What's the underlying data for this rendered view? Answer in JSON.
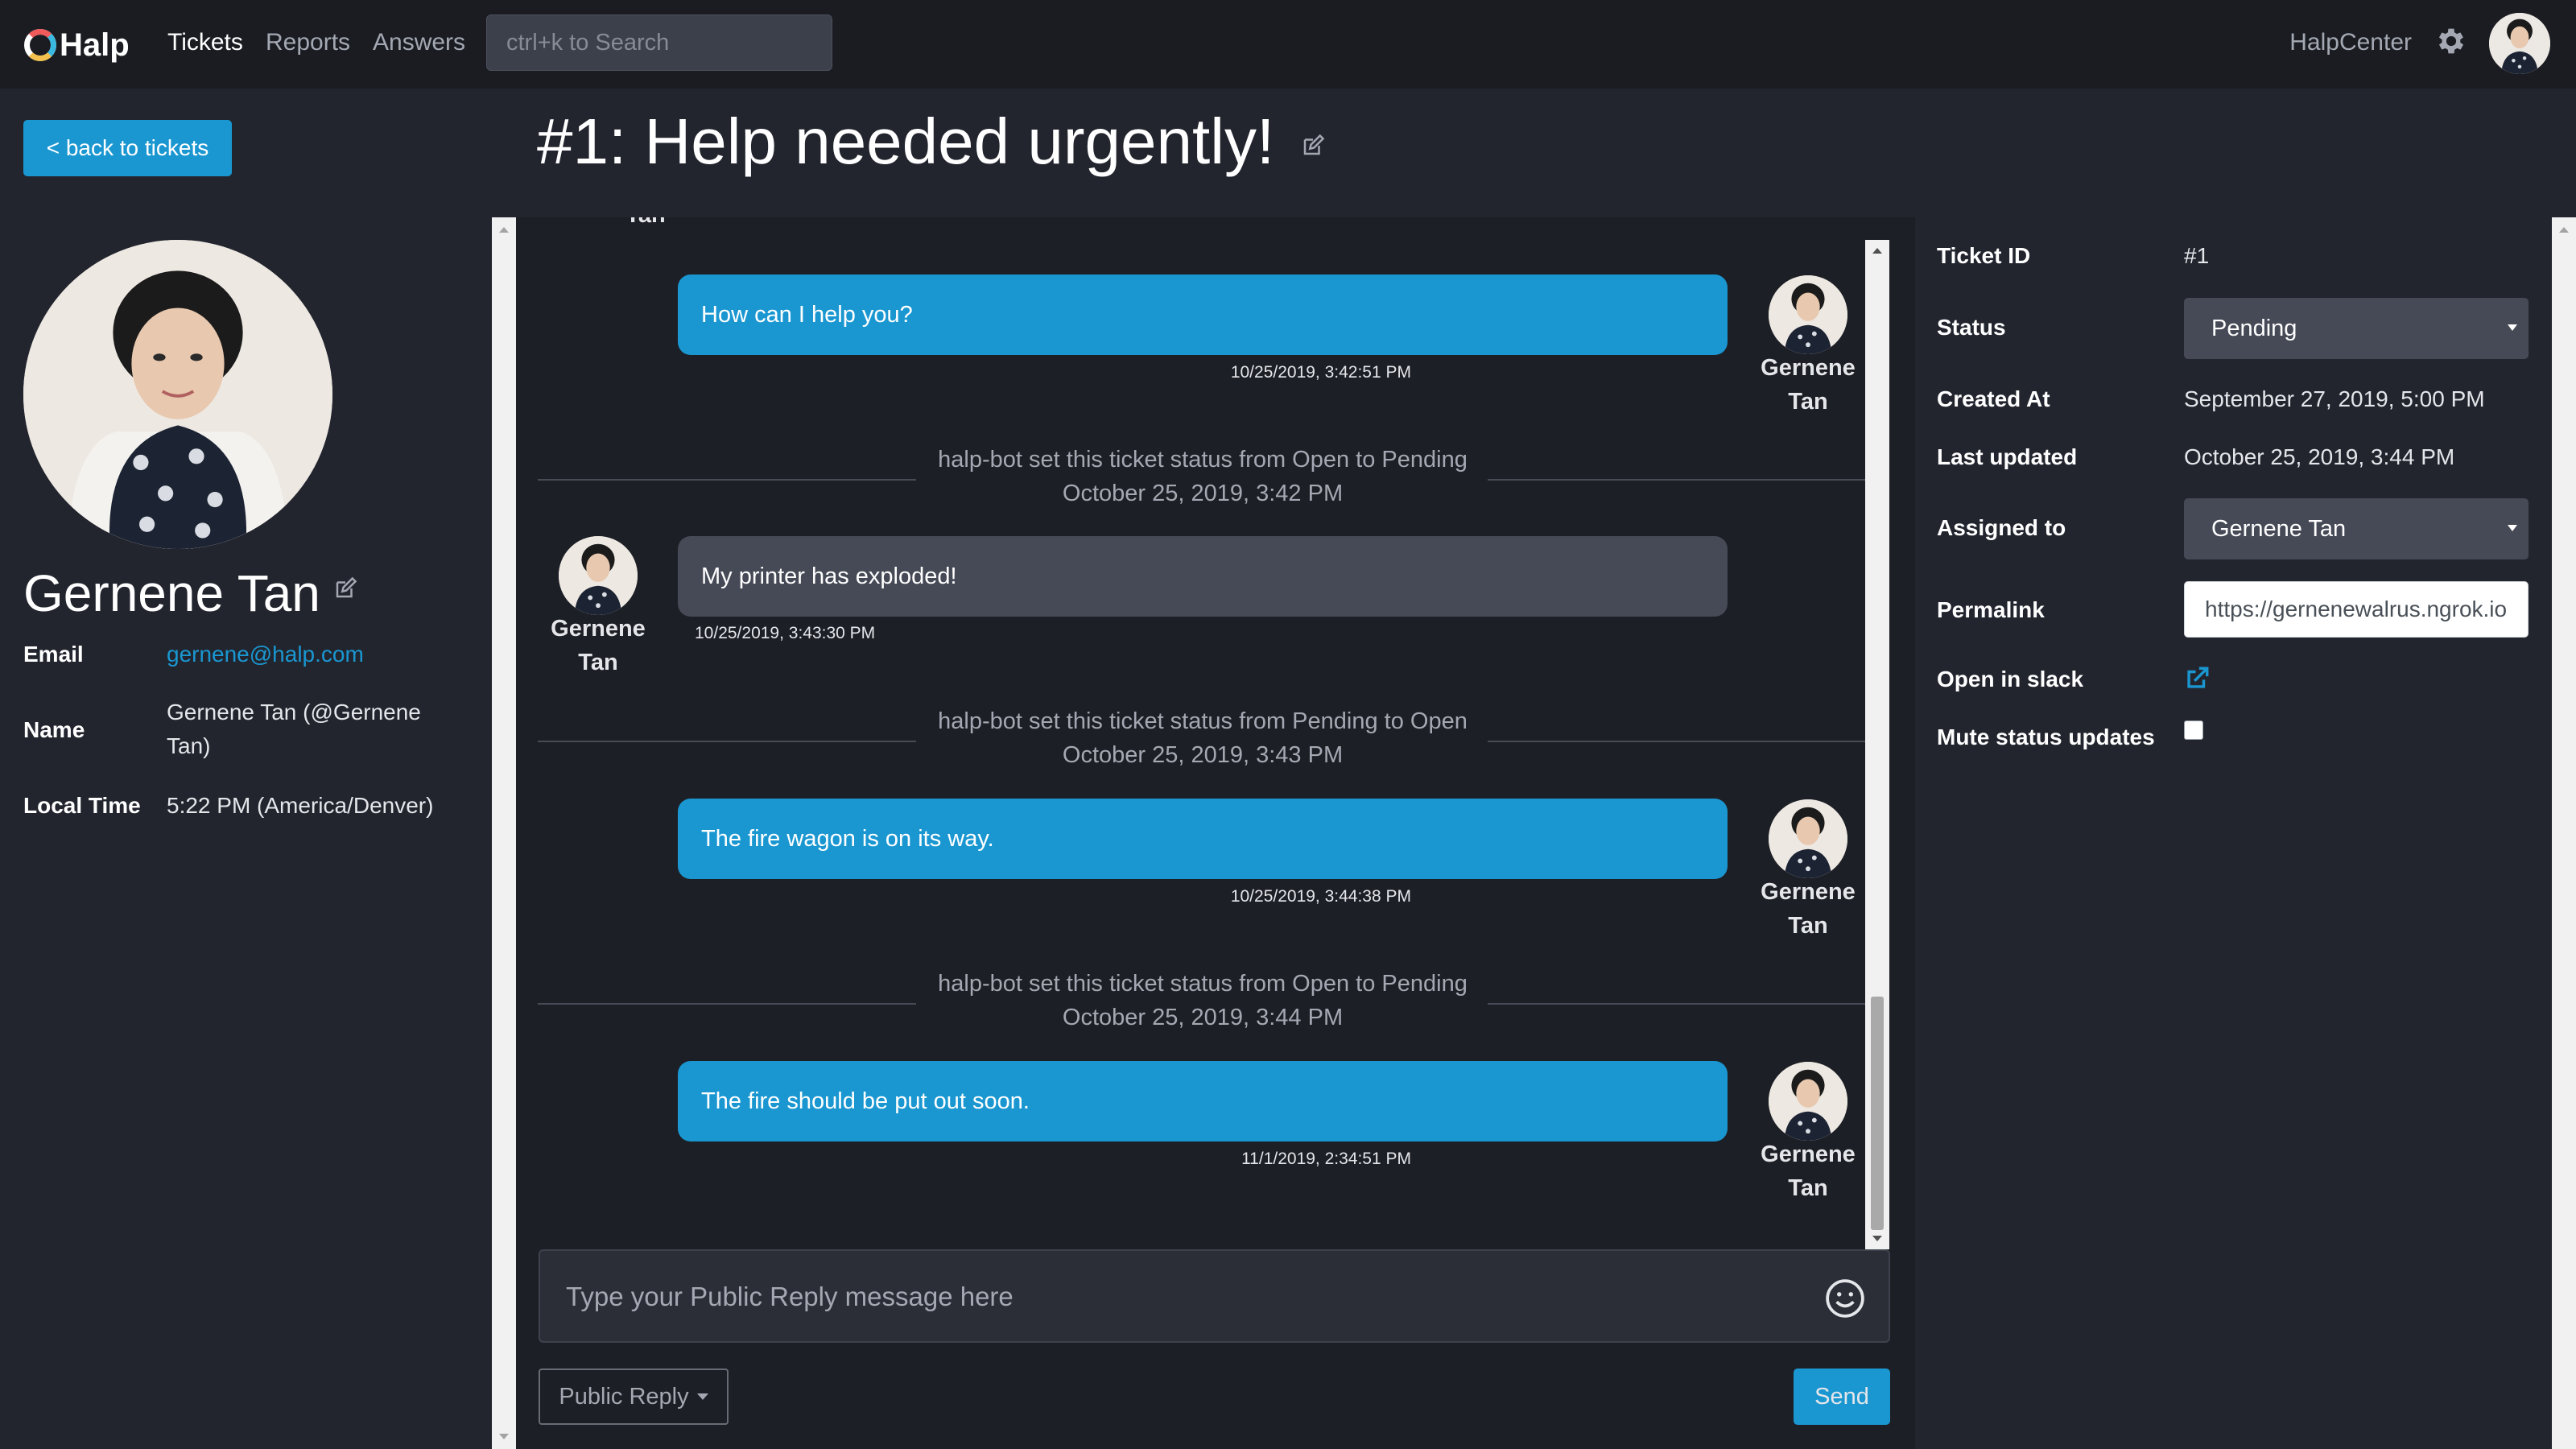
{
  "nav": {
    "logo_text": "Halp",
    "links": [
      "Tickets",
      "Reports",
      "Answers"
    ],
    "active": "Tickets",
    "search_placeholder": "ctrl+k to Search",
    "halpcenter": "HalpCenter",
    "icons": {
      "settings": "gear-icon",
      "avatar": "user-avatar"
    }
  },
  "back_button": "< back to tickets",
  "requester": {
    "name": "Gernene Tan",
    "email_label": "Email",
    "email": "gernene@halp.com",
    "name_label": "Name",
    "display_name_line1": "Gernene Tan (@Gernene",
    "display_name_line2": "Tan)",
    "local_time_label": "Local Time",
    "local_time": "5:22 PM (America/Denver)"
  },
  "ticket": {
    "title": "#1: Help needed urgently!"
  },
  "messages": [
    {
      "type": "agent",
      "text": "How can I help you?",
      "timestamp": "10/25/2019, 3:42:51 PM",
      "author_first": "Gernene",
      "author_last": "Tan"
    },
    {
      "type": "system",
      "text": "halp-bot set this ticket status from Open to Pending",
      "date": "October 25, 2019, 3:42 PM"
    },
    {
      "type": "user",
      "text": "My printer has exploded!",
      "timestamp": "10/25/2019, 3:43:30 PM",
      "author_first": "Gernene",
      "author_last": "Tan"
    },
    {
      "type": "system",
      "text": "halp-bot set this ticket status from Pending to Open",
      "date": "October 25, 2019, 3:43 PM"
    },
    {
      "type": "agent",
      "text": "The fire wagon is on its way.",
      "timestamp": "10/25/2019, 3:44:38 PM",
      "author_first": "Gernene",
      "author_last": "Tan"
    },
    {
      "type": "system",
      "text": "halp-bot set this ticket status from Open to Pending",
      "date": "October 25, 2019, 3:44 PM"
    },
    {
      "type": "agent",
      "text": "The fire should be put out soon.",
      "timestamp": "11/1/2019, 2:34:51 PM",
      "author_first": "Gernene",
      "author_last": "Tan"
    }
  ],
  "composer": {
    "placeholder": "Type your Public Reply message here",
    "mode": "Public Reply",
    "send": "Send"
  },
  "details": {
    "ticket_id_label": "Ticket ID",
    "ticket_id": "#1",
    "status_label": "Status",
    "status": "Pending",
    "created_label": "Created At",
    "created": "September 27, 2019, 5:00 PM",
    "updated_label": "Last updated",
    "updated": "October 25, 2019, 3:44 PM",
    "assigned_label": "Assigned to",
    "assigned": "Gernene Tan",
    "permalink_label": "Permalink",
    "permalink": "https://gernenewalrus.ngrok.io",
    "slack_label": "Open in slack",
    "mute_label": "Mute status updates",
    "mute_checked": false
  },
  "colors": {
    "background": "#22252e",
    "navbar": "#1a1c22",
    "accent": "#1a97d1",
    "user_bubble": "#464a56",
    "muted_text": "#a4a8b2"
  }
}
